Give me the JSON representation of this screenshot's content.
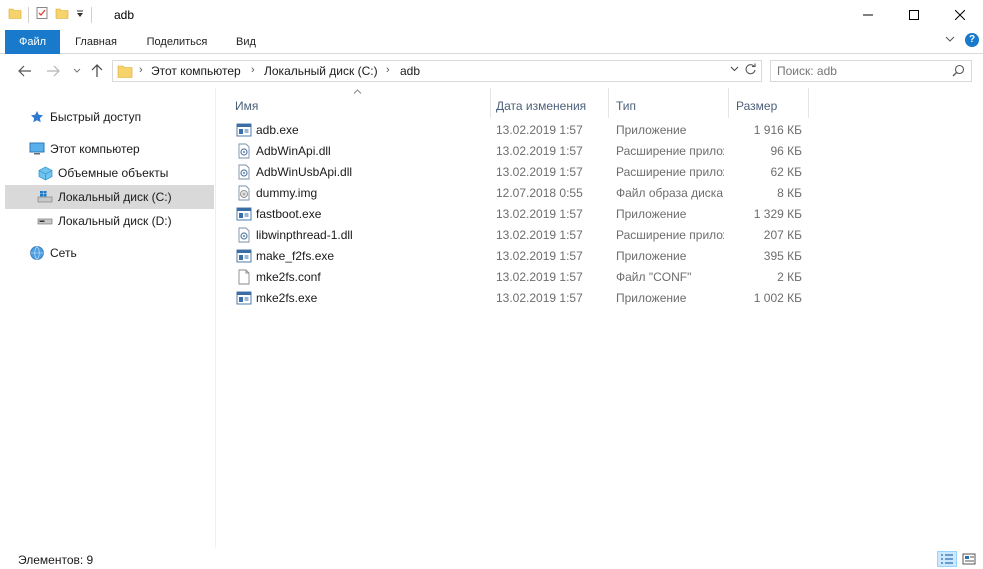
{
  "window": {
    "title": "adb"
  },
  "ribbon": {
    "tabs": [
      "Файл",
      "Главная",
      "Поделиться",
      "Вид"
    ]
  },
  "address": {
    "crumbs": [
      "Этот компьютер",
      "Локальный диск (C:)",
      "adb"
    ]
  },
  "search": {
    "placeholder": "Поиск: adb"
  },
  "sidebar": {
    "items": [
      {
        "label": "Быстрый доступ",
        "icon": "star-icon"
      },
      {
        "label": "Этот компьютер",
        "icon": "computer-icon"
      },
      {
        "label": "Объемные объекты",
        "icon": "cube-icon"
      },
      {
        "label": "Локальный диск (C:)",
        "icon": "windows-drive-icon",
        "selected": true
      },
      {
        "label": "Локальный диск (D:)",
        "icon": "drive-icon"
      },
      {
        "label": "Сеть",
        "icon": "network-icon"
      }
    ]
  },
  "columns": {
    "name": "Имя",
    "date": "Дата изменения",
    "type": "Тип",
    "size": "Размер"
  },
  "files": [
    {
      "name": "adb.exe",
      "date": "13.02.2019 1:57",
      "type": "Приложение",
      "size": "1 916 КБ",
      "icon": "exe-icon"
    },
    {
      "name": "AdbWinApi.dll",
      "date": "13.02.2019 1:57",
      "type": "Расширение приложения",
      "size": "96 КБ",
      "icon": "dll-icon"
    },
    {
      "name": "AdbWinUsbApi.dll",
      "date": "13.02.2019 1:57",
      "type": "Расширение приложения",
      "size": "62 КБ",
      "icon": "dll-icon"
    },
    {
      "name": "dummy.img",
      "date": "12.07.2018 0:55",
      "type": "Файл образа диска",
      "size": "8 КБ",
      "icon": "disc-image-icon"
    },
    {
      "name": "fastboot.exe",
      "date": "13.02.2019 1:57",
      "type": "Приложение",
      "size": "1 329 КБ",
      "icon": "exe-icon"
    },
    {
      "name": "libwinpthread-1.dll",
      "date": "13.02.2019 1:57",
      "type": "Расширение приложения",
      "size": "207 КБ",
      "icon": "dll-icon"
    },
    {
      "name": "make_f2fs.exe",
      "date": "13.02.2019 1:57",
      "type": "Приложение",
      "size": "395 КБ",
      "icon": "exe-icon"
    },
    {
      "name": "mke2fs.conf",
      "date": "13.02.2019 1:57",
      "type": "Файл \"CONF\"",
      "size": "2 КБ",
      "icon": "blank-file-icon"
    },
    {
      "name": "mke2fs.exe",
      "date": "13.02.2019 1:57",
      "type": "Приложение",
      "size": "1 002 КБ",
      "icon": "exe-icon"
    }
  ],
  "status": {
    "items_count": "Элементов: 9"
  },
  "colors": {
    "accent": "#1979ca",
    "selected_nav": "#d9d9d9",
    "folder": "#f6d36b"
  }
}
